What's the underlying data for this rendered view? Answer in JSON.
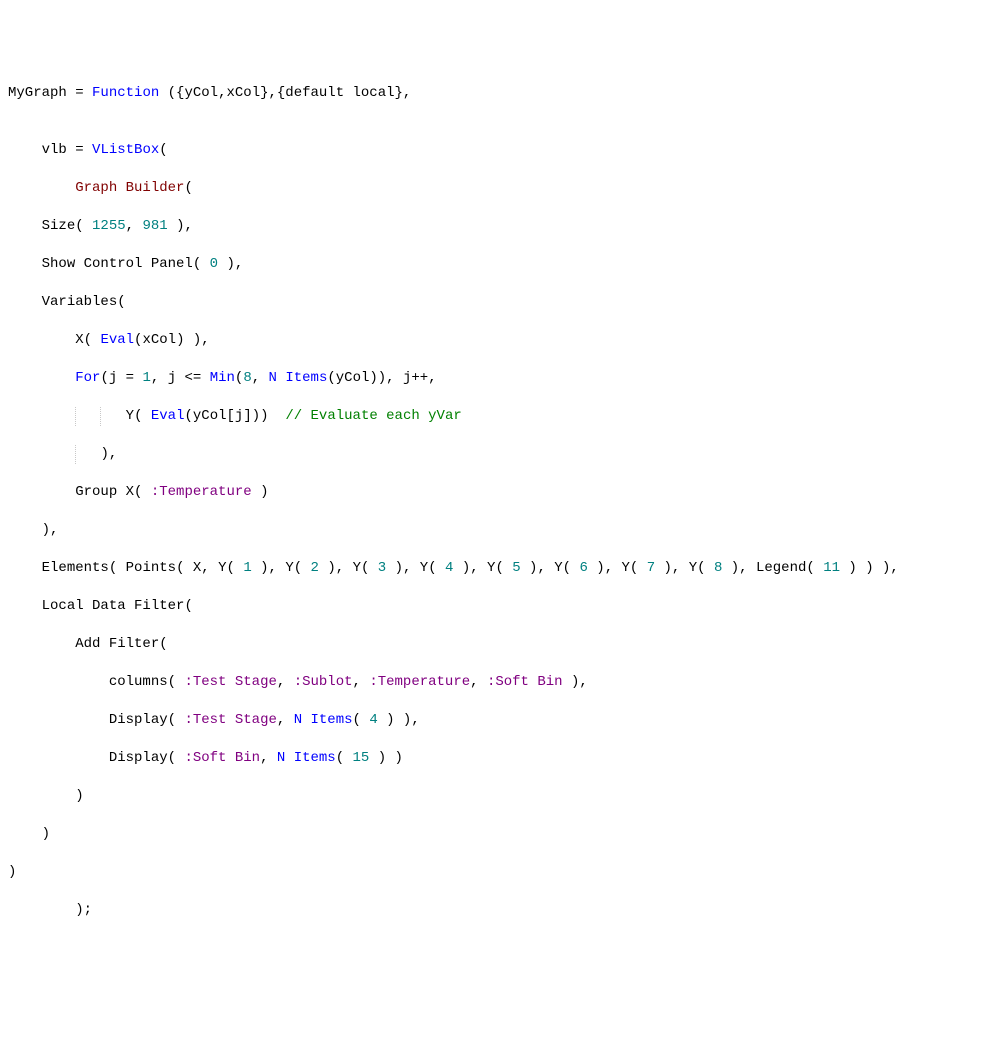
{
  "colors": {
    "default": "#000000",
    "blue": "#0000ff",
    "teal": "#008080",
    "darkred": "#800000",
    "purple": "#800080",
    "green": "#008000"
  },
  "code": {
    "l1": {
      "t1": "MyGraph",
      "t2": " = ",
      "t3": "Function",
      "t4": " ({",
      "t5": "yCol",
      "t6": ",",
      "t7": "xCol",
      "t8": "},{default local},"
    },
    "l3": {
      "t1": "vlb",
      "t2": " = ",
      "t3": "VListBox",
      "t4": "("
    },
    "l4": {
      "t1": "Graph Builder",
      "t2": "("
    },
    "l5": {
      "t1": "Size",
      "t2": "( ",
      "t3": "1255",
      "t4": ", ",
      "t5": "981",
      "t6": " ),"
    },
    "l6": {
      "t1": "Show Control Panel",
      "t2": "( ",
      "t3": "0",
      "t4": " ),"
    },
    "l7": {
      "t1": "Variables",
      "t2": "("
    },
    "l8": {
      "t1": "X",
      "t2": "( ",
      "t3": "Eval",
      "t4": "(",
      "t5": "xCol",
      "t6": ") ),"
    },
    "l9": {
      "t1": "For",
      "t2": "(",
      "t3": "j",
      "t4": " = ",
      "t5": "1",
      "t6": ", ",
      "t7": "j",
      "t8": " <= ",
      "t9": "Min",
      "t10": "(",
      "t11": "8",
      "t12": ", ",
      "t13": "N Items",
      "t14": "(",
      "t15": "yCol",
      "t16": ")), ",
      "t17": "j",
      "t18": "++,"
    },
    "l10": {
      "t1": "Y",
      "t2": "( ",
      "t3": "Eval",
      "t4": "(",
      "t5": "yCol",
      "t6": "[",
      "t7": "j",
      "t8": "]))  ",
      "t9": "// Evaluate each yVar"
    },
    "l11": {
      "t1": "),"
    },
    "l12": {
      "t1": "Group X",
      "t2": "( ",
      "t3": ":Temperature",
      "t4": " )"
    },
    "l13": {
      "t1": "),"
    },
    "l14": {
      "t1": "Elements",
      "t2": "( ",
      "t3": "Points",
      "t4": "( ",
      "t5": "X",
      "t6": ", ",
      "t7": "Y",
      "t8": "( ",
      "n1": "1",
      "t9": " ), ",
      "n2": "2",
      "n3": "3",
      "n4": "4",
      "n5": "5",
      "n6": "6",
      "n7": "7",
      "n8": "8",
      "t10": "Legend",
      "n9": "11",
      "t11": " ) ) ),"
    },
    "l15": {
      "t1": "Local Data Filter",
      "t2": "("
    },
    "l16": {
      "t1": "Add Filter",
      "t2": "("
    },
    "l17": {
      "t1": "columns",
      "t2": "( ",
      "t3": ":Test Stage",
      "t4": ", ",
      "t5": ":Sublot",
      "t6": ", ",
      "t7": ":Temperature",
      "t8": ", ",
      "t9": ":Soft Bin",
      "t10": " ),"
    },
    "l18": {
      "t1": "Display",
      "t2": "( ",
      "t3": ":Test Stage",
      "t4": ", ",
      "t5": "N Items",
      "t6": "( ",
      "t7": "4",
      "t8": " ) ),"
    },
    "l19": {
      "t1": "Display",
      "t2": "( ",
      "t3": ":Soft Bin",
      "t4": ", ",
      "t5": "N Items",
      "t6": "( ",
      "t7": "15",
      "t8": " ) )"
    },
    "l20": {
      "t1": ")"
    },
    "l21": {
      "t1": ")"
    },
    "l22": {
      "t1": ")"
    },
    "l23": {
      "t1": ");"
    }
  }
}
